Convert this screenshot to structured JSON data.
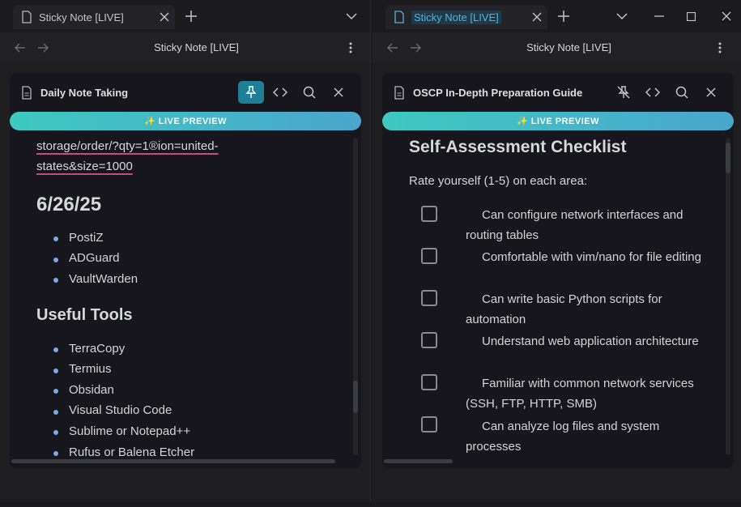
{
  "left": {
    "tab_label": "Sticky Note [LIVE]",
    "nav_title": "Sticky Note [LIVE]",
    "note_title": "Daily Note Taking",
    "live_banner": "✨ LIVE PREVIEW",
    "link_lines": [
      "storage/order/?qty=1®ion=united-",
      "states&size=1000"
    ],
    "date_heading": "6/26/25",
    "date_items": [
      "PostiZ",
      "ADGuard",
      "VaultWarden"
    ],
    "tools_heading": "Useful Tools",
    "tools_items": [
      "TerraCopy",
      "Termius",
      "Obsidan",
      "Visual Studio Code",
      "Sublime or Notepad++",
      "Rufus or Balena Etcher"
    ],
    "pin_active": true
  },
  "right": {
    "tab_label": "Sticky Note [LIVE]",
    "nav_title": "Sticky Note [LIVE]",
    "note_title": "OSCP In-Depth Preparation Guide",
    "live_banner": "✨ LIVE PREVIEW",
    "heading": "Self-Assessment Checklist",
    "intro": "Rate yourself (1-5) on each area:",
    "checklist": [
      "Can configure network interfaces and routing tables",
      "Comfortable with vim/nano for file editing",
      "Can write basic Python scripts for automation",
      "Understand web application architecture",
      "Familiar with common network services (SSH, FTP, HTTP, SMB)",
      "Can analyze log files and system processes"
    ],
    "pin_active": false
  },
  "colors": {
    "accent": "#1f7f96",
    "banner_start": "#3ec9c1",
    "banner_end": "#4aa6cc",
    "link_underline": "#c34b84",
    "bullet": "#7aa8e8",
    "active_tab_text": "#4fb3d9"
  },
  "icons": {
    "doc": "file-icon",
    "close": "close-icon",
    "new_tab": "plus-icon",
    "menu": "chevron-down-icon",
    "back": "arrow-left-icon",
    "forward": "arrow-right-icon",
    "more": "more-vertical-icon",
    "pin": "pin-icon",
    "unpin": "pin-off-icon",
    "code": "code-icon",
    "search": "search-icon",
    "minimize": "minimize-icon",
    "maximize": "maximize-icon"
  }
}
